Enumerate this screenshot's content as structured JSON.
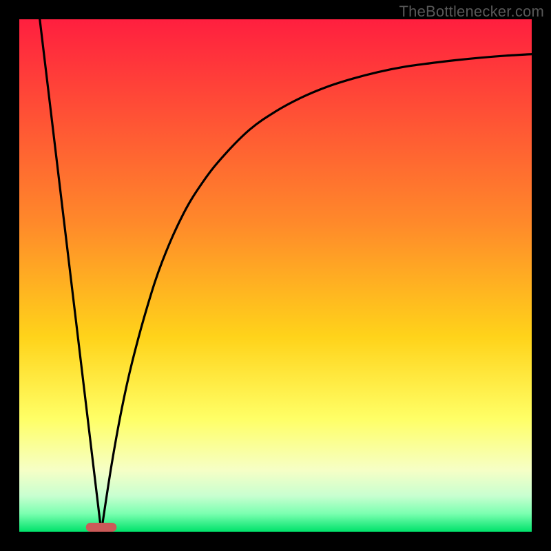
{
  "watermark": "TheBottlenecker.com",
  "chart_data": {
    "type": "line",
    "title": "",
    "xlabel": "",
    "ylabel": "",
    "xlim": [
      0,
      100
    ],
    "ylim": [
      0,
      100
    ],
    "sweet_spot": {
      "center_x": 16,
      "width": 6
    },
    "gradient_stops": [
      {
        "offset": 0.0,
        "color": "#ff1f3f"
      },
      {
        "offset": 0.4,
        "color": "#ff8a2a"
      },
      {
        "offset": 0.62,
        "color": "#ffd31a"
      },
      {
        "offset": 0.78,
        "color": "#ffff66"
      },
      {
        "offset": 0.88,
        "color": "#f6ffc6"
      },
      {
        "offset": 0.93,
        "color": "#c8ffd0"
      },
      {
        "offset": 0.965,
        "color": "#7affb0"
      },
      {
        "offset": 1.0,
        "color": "#00e26a"
      }
    ],
    "series": [
      {
        "name": "left-line",
        "x": [
          4,
          16
        ],
        "y": [
          100,
          0
        ]
      },
      {
        "name": "right-curve",
        "x": [
          16,
          18,
          20,
          22,
          25,
          28,
          32,
          36,
          40,
          45,
          50,
          55,
          60,
          65,
          70,
          75,
          80,
          85,
          90,
          95,
          100
        ],
        "y": [
          0,
          13,
          24,
          33,
          44,
          53,
          62,
          68.5,
          73.5,
          78.5,
          82,
          84.7,
          86.8,
          88.4,
          89.7,
          90.7,
          91.4,
          92.0,
          92.5,
          92.9,
          93.2
        ]
      }
    ],
    "marker": {
      "color": "#cb5a58",
      "rx": 14
    }
  }
}
